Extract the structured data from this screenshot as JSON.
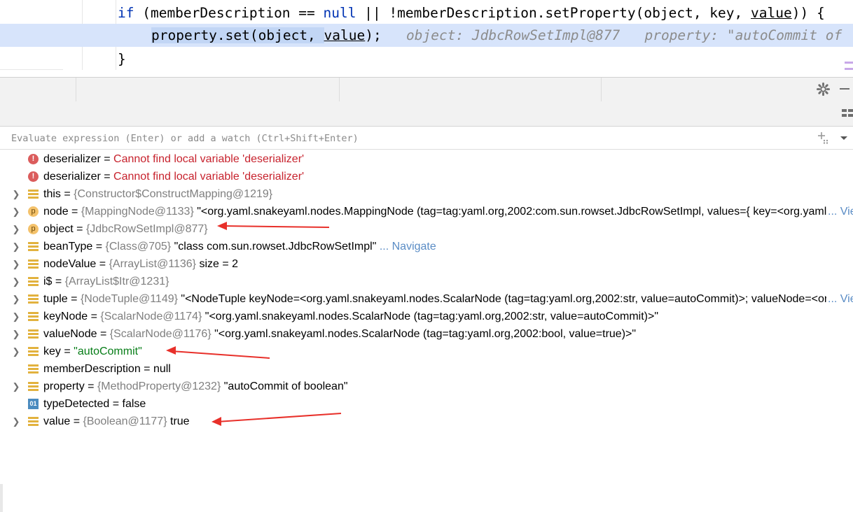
{
  "editor": {
    "line1": {
      "kw_if": "if",
      "part1": " (memberDescription == ",
      "kw_null": "null",
      "part2": " || !memberDescription.setProperty(object, key, ",
      "u_value": "value",
      "part3": ")) {"
    },
    "line2": {
      "part1": "property.set(object, ",
      "u_value": "value",
      "part2": ");",
      "hint": "object: JdbcRowSetImpl@877   property: \"autoCommit of"
    },
    "line3": "}"
  },
  "toolbar": {
    "settings_icon": "gear-icon",
    "minimize_icon": "minus-icon",
    "layout_icon": "layout-icon"
  },
  "evaluate": {
    "placeholder": "Evaluate expression (Enter) or add a watch (Ctrl+Shift+Enter)"
  },
  "variables": {
    "rows": [
      {
        "icon": "error-icon",
        "name": "deserializer",
        "eq": " = ",
        "error": "Cannot find local variable 'deserializer'"
      },
      {
        "icon": "error-icon",
        "name": "deserializer",
        "eq": " = ",
        "error": "Cannot find local variable 'deserializer'"
      },
      {
        "icon": "field-icon",
        "name": "this",
        "eq": " = ",
        "ref": "{Constructor$ConstructMapping@1219}"
      },
      {
        "icon": "parameter-icon",
        "name": "node",
        "eq": " = ",
        "ref": "{MappingNode@1133}",
        "value": " \"<org.yaml.snakeyaml.nodes.MappingNode (tag=tag:yaml.org,2002:com.sun.rowset.JdbcRowSetImpl, values={ key=<org.yaml.snakeyaml.nodes.ScalarNode",
        "more": "... View"
      },
      {
        "icon": "parameter-icon",
        "name": "object",
        "eq": " = ",
        "ref": "{JdbcRowSetImpl@877}"
      },
      {
        "icon": "field-icon",
        "name": "beanType",
        "eq": " = ",
        "ref": "{Class@705}",
        "value": " \"class com.sun.rowset.JdbcRowSetImpl\"",
        "link": " ... Navigate"
      },
      {
        "icon": "field-icon",
        "name": "nodeValue",
        "eq": " = ",
        "ref": "{ArrayList@1136}",
        "value": "  size = 2"
      },
      {
        "icon": "field-icon",
        "name": "i$",
        "eq": " = ",
        "ref": "{ArrayList$Itr@1231}"
      },
      {
        "icon": "field-icon",
        "name": "tuple",
        "eq": " = ",
        "ref": "{NodeTuple@1149}",
        "value": " \"<NodeTuple keyNode=<org.yaml.snakeyaml.nodes.ScalarNode (tag=tag:yaml.org,2002:str, value=autoCommit)>; valueNode=<org.yaml",
        "more": "... View"
      },
      {
        "icon": "field-icon",
        "name": "keyNode",
        "eq": " = ",
        "ref": "{ScalarNode@1174}",
        "value": " \"<org.yaml.snakeyaml.nodes.ScalarNode (tag=tag:yaml.org,2002:str, value=autoCommit)>\""
      },
      {
        "icon": "field-icon",
        "name": "valueNode",
        "eq": " = ",
        "ref": "{ScalarNode@1176}",
        "value": " \"<org.yaml.snakeyaml.nodes.ScalarNode (tag=tag:yaml.org,2002:bool, value=true)>\""
      },
      {
        "icon": "field-icon",
        "name": "key",
        "eq": " = ",
        "strval": "\"autoCommit\""
      },
      {
        "icon": "field-icon",
        "name": "memberDescription",
        "eq": " = ",
        "value": "null"
      },
      {
        "icon": "field-icon",
        "name": "property",
        "eq": " = ",
        "ref": "{MethodProperty@1232}",
        "value": " \"autoCommit of boolean\""
      },
      {
        "icon": "boolean-icon",
        "name": "typeDetected",
        "eq": " = ",
        "value": "false"
      },
      {
        "icon": "field-icon",
        "name": "value",
        "eq": " = ",
        "ref": "{Boolean@1177}",
        "value": " true"
      }
    ]
  },
  "icon_glyphs": {
    "error": "!",
    "parameter": "p",
    "boolean": "01"
  },
  "colors": {
    "execution_line": "#d7e4fb",
    "error_text": "#c7222d",
    "string_value": "#067d17",
    "annotation_arrow": "#e8302a",
    "link": "#5a8cc5"
  }
}
